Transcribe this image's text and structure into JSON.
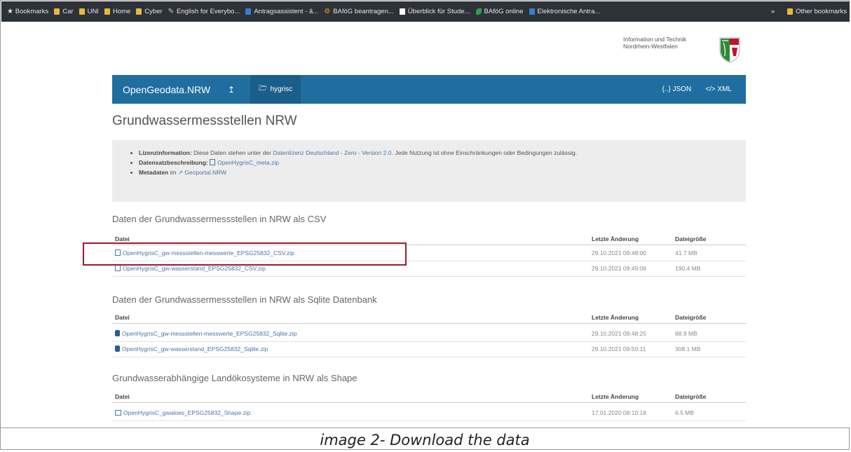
{
  "bookmarks": [
    {
      "label": "Bookmarks",
      "icon": "star-icon"
    },
    {
      "label": "Car",
      "icon": "folder-icon"
    },
    {
      "label": "UNI",
      "icon": "folder-icon"
    },
    {
      "label": "Home",
      "icon": "folder-icon"
    },
    {
      "label": "Cyber",
      "icon": "folder-icon"
    },
    {
      "label": "English for Everybo...",
      "icon": "feather-icon"
    },
    {
      "label": "Antragsassistent - â...",
      "icon": "page-icon"
    },
    {
      "label": "BAföG beantragen...",
      "icon": "gear-icon"
    },
    {
      "label": "Überblick für Stude...",
      "icon": "page-icon"
    },
    {
      "label": "BAföG online",
      "icon": "leaf-icon"
    },
    {
      "label": "Elektronische Antra...",
      "icon": "page-icon"
    }
  ],
  "other_bookmarks": "Other bookmarks",
  "header": {
    "gov_line1": "Information und Technik",
    "gov_line2": "Nordrhein-Westfalen"
  },
  "nav": {
    "brand": "OpenGeodata.NRW",
    "up_arrow": "↥",
    "folder": "hygrisc",
    "json": "{..} JSON",
    "xml": "</> XML"
  },
  "page_title": "Grundwassermessstellen NRW",
  "info": {
    "license_label": "Lizenzinformation:",
    "license_text": "Diese Daten stehen unter der",
    "license_link": "Datenlizenz Deutschland - Zero - Version 2.0",
    "license_rest": ". Jede Nutzung ist ohne Einschränkungen oder Bedingungen zulässig.",
    "desc_label": "Datensatzbeschreibung:",
    "desc_link": "OpenHygrisC_meta.zip",
    "meta_label": "Metadaten",
    "meta_in": "im",
    "meta_link": "Geoportal.NRW"
  },
  "columns": {
    "file": "Datei",
    "changed": "Letzte Änderung",
    "size": "Dateigröße"
  },
  "sections": [
    {
      "title": "Daten der Grundwassermessstellen in NRW als CSV",
      "rows": [
        {
          "file": "OpenHygrisC_gw-messstellen-messwerte_EPSG25832_CSV.zip",
          "changed": "29.10.2021 09:48:00",
          "size": "41.7 MB"
        },
        {
          "file": "OpenHygrisC_gw-wasserstand_EPSG25832_CSV.zip",
          "changed": "29.10.2021 09:49:06",
          "size": "190.4 MB"
        }
      ]
    },
    {
      "title": "Daten der Grundwassermessstellen in NRW als Sqlite Datenbank",
      "rows": [
        {
          "file": "OpenHygrisC_gw-messstellen-messwerte_EPSG25832_Sqlite.zip",
          "changed": "29.10.2021 09:48:25",
          "size": "88.9 MB"
        },
        {
          "file": "OpenHygrisC_gw-wasserstand_EPSG25832_Sqlite.zip",
          "changed": "29.10.2021 09:50:11",
          "size": "308.1 MB"
        }
      ]
    },
    {
      "title": "Grundwasserabhängige Landökosysteme in NRW als Shape",
      "rows": [
        {
          "file": "OpenHygrisC_gwaloes_EPSG25832_Shape.zip",
          "changed": "17.01.2020 08:10:18",
          "size": "6.5 MB"
        }
      ]
    }
  ],
  "caption": "image 2- Download the data"
}
